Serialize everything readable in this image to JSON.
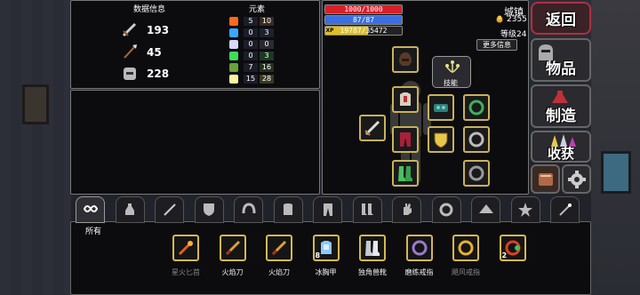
{
  "stats_panel": {
    "title": "数据信息",
    "attack": "193",
    "speed": "45",
    "defense": "228"
  },
  "elements_panel": {
    "title": "元素",
    "rows": [
      {
        "name": "fire",
        "color": "#ff6a1a",
        "a": "5",
        "b": "10"
      },
      {
        "name": "water",
        "color": "#3aa8ff",
        "a": "0",
        "b": "3"
      },
      {
        "name": "air",
        "color": "#d8d8ff",
        "a": "0",
        "b": "0"
      },
      {
        "name": "nature",
        "color": "#3fdc5a",
        "a": "0",
        "b": "3"
      },
      {
        "name": "earth",
        "color": "#6aa03a",
        "a": "7",
        "b": "16"
      },
      {
        "name": "light",
        "color": "#fff3a0",
        "a": "15",
        "b": "28"
      }
    ]
  },
  "bars": {
    "hp": {
      "text": "1000/1000",
      "fraction": 1.0,
      "color": "#d8202a"
    },
    "mp": {
      "text": "87/87",
      "fraction": 1.0,
      "color": "#3a6ee0"
    },
    "xp": {
      "tag": "XP",
      "text": "19787/35472",
      "fraction": 0.558,
      "color": "#e0c020"
    }
  },
  "location": {
    "name": "城镇",
    "gold": "2355",
    "level": "等级24"
  },
  "more_info_button": "更多信息",
  "skills_button": "技能",
  "side_menu": {
    "back": "返回",
    "items": "物品",
    "craft": "制造",
    "harvest": "收获"
  },
  "tabs": [
    {
      "name": "all",
      "label": "所有",
      "icon": "infinity-icon"
    },
    {
      "name": "potion",
      "icon": "potion-icon"
    },
    {
      "name": "sword",
      "icon": "sword-icon"
    },
    {
      "name": "shield",
      "icon": "shield-icon"
    },
    {
      "name": "helmet",
      "icon": "helmet-icon"
    },
    {
      "name": "armor",
      "icon": "armor-icon"
    },
    {
      "name": "pants",
      "icon": "pants-icon"
    },
    {
      "name": "boots",
      "icon": "boots-icon"
    },
    {
      "name": "gloves",
      "icon": "gloves-icon"
    },
    {
      "name": "ring",
      "icon": "ring-icon"
    },
    {
      "name": "hat",
      "icon": "hat-icon"
    },
    {
      "name": "star",
      "icon": "star-icon"
    },
    {
      "name": "wand",
      "icon": "wand-icon"
    }
  ],
  "inventory": [
    {
      "label": "星火匕首",
      "icon": "firestar-dagger-icon",
      "dim": true,
      "count": ""
    },
    {
      "label": "火焰刀",
      "icon": "flame-blade-icon",
      "dim": false,
      "count": ""
    },
    {
      "label": "火焰刀",
      "icon": "flame-blade-icon",
      "dim": false,
      "count": ""
    },
    {
      "label": "冰胸甲",
      "icon": "ice-chestplate-icon",
      "dim": false,
      "count": "8"
    },
    {
      "label": "独角兽靴",
      "icon": "unicorn-boots-icon",
      "dim": false,
      "count": ""
    },
    {
      "label": "磨练戒指",
      "icon": "honing-ring-icon",
      "dim": false,
      "count": ""
    },
    {
      "label": "飓风戒指",
      "icon": "hurricane-ring-icon",
      "dim": true,
      "count": ""
    },
    {
      "label": "",
      "icon": "fire-ring-icon",
      "dim": false,
      "count": "2"
    }
  ]
}
